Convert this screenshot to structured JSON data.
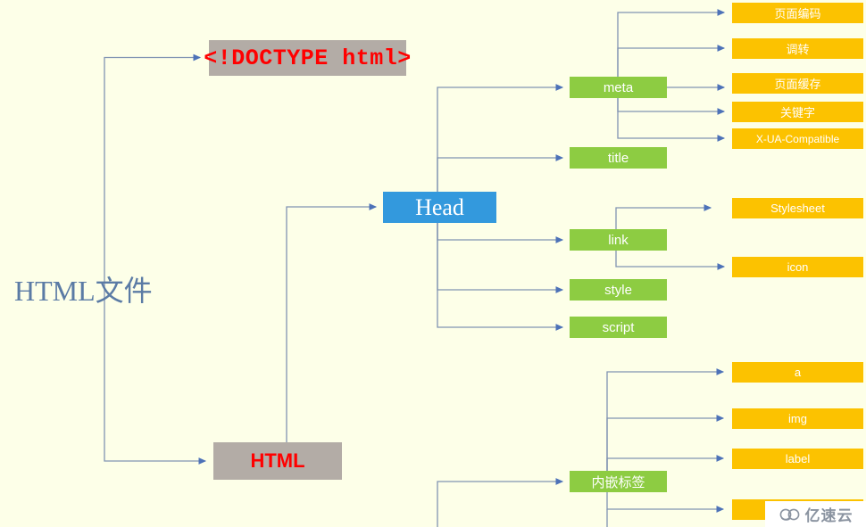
{
  "diagram": {
    "title": "HTML文件",
    "type": "tree-diagram",
    "background_color": "#fdffe8",
    "edge_color": "#8193b2",
    "root": {
      "label": "HTML文件",
      "text_color": "#5b7ba5"
    },
    "nodes": {
      "doctype": {
        "label": "<!DOCTYPE html>",
        "fill": "#b3aca6",
        "text_color": "#ff0000"
      },
      "html": {
        "label": "HTML",
        "fill": "#b3aca6",
        "text_color": "#ff0000"
      },
      "head": {
        "label": "Head",
        "fill": "#3399dd",
        "text_color": "#ffffff"
      },
      "meta": {
        "label": "meta",
        "fill": "#8dcc42",
        "text_color": "#ffffff"
      },
      "title": {
        "label": "title",
        "fill": "#8dcc42",
        "text_color": "#ffffff"
      },
      "link": {
        "label": "link",
        "fill": "#8dcc42",
        "text_color": "#ffffff"
      },
      "style": {
        "label": "style",
        "fill": "#8dcc42",
        "text_color": "#ffffff"
      },
      "script": {
        "label": "script",
        "fill": "#8dcc42",
        "text_color": "#ffffff"
      },
      "inline_tags": {
        "label": "内嵌标签",
        "fill": "#8dcc42",
        "text_color": "#ffffff"
      },
      "meta_charset": {
        "label": "页面编码",
        "fill": "#fcc200",
        "text_color": "#ffffff"
      },
      "meta_redirect": {
        "label": "调转",
        "fill": "#fcc200",
        "text_color": "#ffffff"
      },
      "meta_cache": {
        "label": "页面缓存",
        "fill": "#fcc200",
        "text_color": "#ffffff"
      },
      "meta_keywords": {
        "label": "关键字",
        "fill": "#fcc200",
        "text_color": "#ffffff"
      },
      "meta_xua": {
        "label": "X-UA-Compatible",
        "fill": "#fcc200",
        "text_color": "#ffffff"
      },
      "link_stylesheet": {
        "label": "Stylesheet",
        "fill": "#fcc200",
        "text_color": "#ffffff"
      },
      "link_icon": {
        "label": "icon",
        "fill": "#fcc200",
        "text_color": "#ffffff"
      },
      "tag_a": {
        "label": "a",
        "fill": "#fcc200",
        "text_color": "#ffffff"
      },
      "tag_img": {
        "label": "img",
        "fill": "#fcc200",
        "text_color": "#ffffff"
      },
      "tag_label": {
        "label": "label",
        "fill": "#fcc200",
        "text_color": "#ffffff"
      },
      "tag_cutoff": {
        "label": "",
        "fill": "#fcc200",
        "text_color": "#ffffff"
      }
    },
    "edges": [
      {
        "from": "root",
        "to": "doctype"
      },
      {
        "from": "root",
        "to": "html"
      },
      {
        "from": "html",
        "to": "head"
      },
      {
        "from": "head",
        "to": "meta"
      },
      {
        "from": "head",
        "to": "title"
      },
      {
        "from": "head",
        "to": "link"
      },
      {
        "from": "head",
        "to": "style"
      },
      {
        "from": "head",
        "to": "script"
      },
      {
        "from": "meta",
        "to": "meta_charset"
      },
      {
        "from": "meta",
        "to": "meta_redirect"
      },
      {
        "from": "meta",
        "to": "meta_cache"
      },
      {
        "from": "meta",
        "to": "meta_keywords"
      },
      {
        "from": "meta",
        "to": "meta_xua"
      },
      {
        "from": "link",
        "to": "link_stylesheet"
      },
      {
        "from": "link",
        "to": "link_icon"
      },
      {
        "from": "html",
        "to": "inline_tags"
      },
      {
        "from": "inline_tags",
        "to": "tag_a"
      },
      {
        "from": "inline_tags",
        "to": "tag_img"
      },
      {
        "from": "inline_tags",
        "to": "tag_label"
      },
      {
        "from": "inline_tags",
        "to": "tag_cutoff"
      }
    ]
  },
  "watermark": {
    "text": "亿速云",
    "icon": "cloud-logo-icon",
    "color": "#8a93a0"
  }
}
